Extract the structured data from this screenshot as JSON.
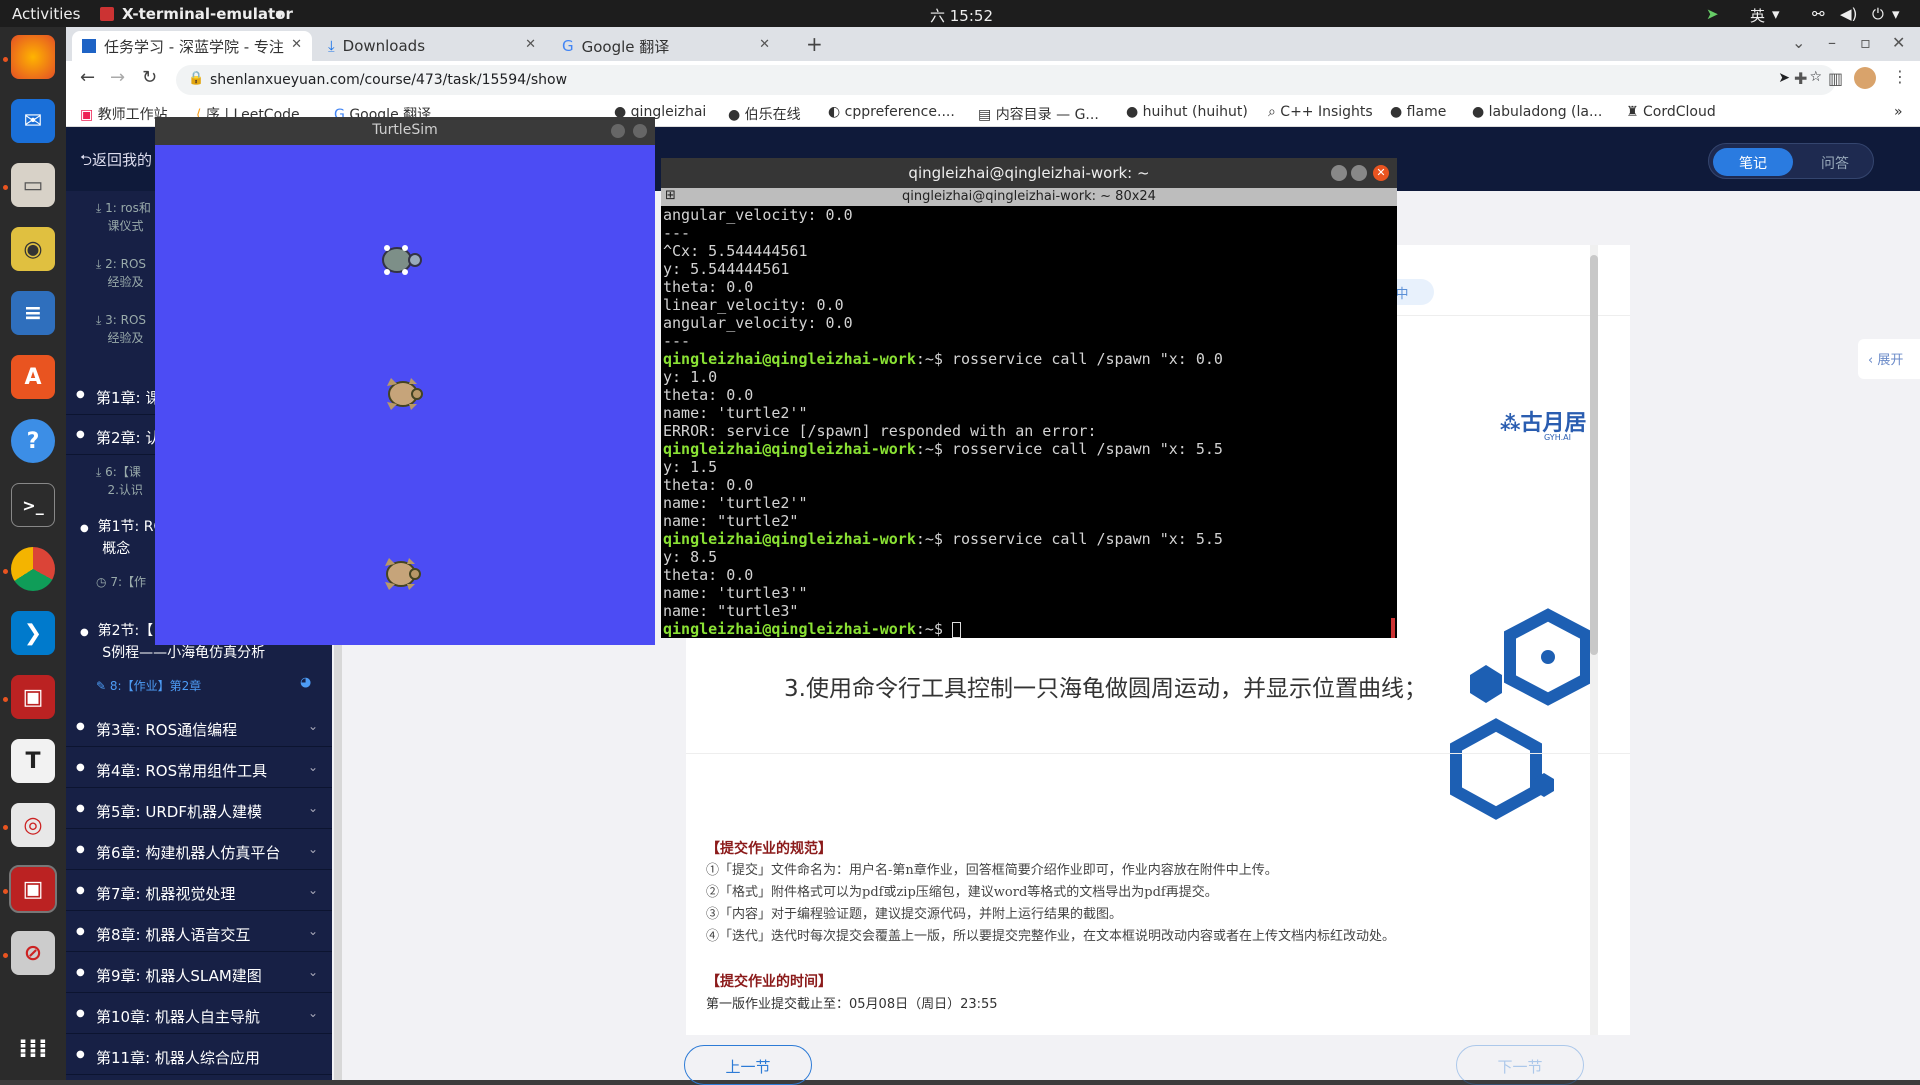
{
  "topbar": {
    "activities": "Activities",
    "app": "X-terminal-emulator",
    "clock": "六 15:52",
    "lang": "英"
  },
  "dock": {
    "items": [
      "firefox",
      "thunderbird",
      "files",
      "rhythmbox",
      "writer",
      "software",
      "help",
      "terminal",
      "chrome",
      "vscode",
      "app-red",
      "typora",
      "app-red2",
      "app-red3",
      "app-blocked",
      "show-apps"
    ]
  },
  "browser": {
    "tabs": [
      {
        "label": "任务学习 - 深蓝学院 - 专注"
      },
      {
        "label": "Downloads"
      },
      {
        "label": "Google 翻译"
      }
    ],
    "new_tab": "+",
    "url": "shenlanxueyuan.com/course/473/task/15594/show",
    "bookmarks": [
      "教师工作站",
      "序 | LeetCode",
      "Google 翻译",
      "qingleizhai",
      "伯乐在线",
      "cppreference....",
      "内容目录 — G...",
      "huihut (huihut)",
      "C++ Insights",
      "flame",
      "labuladong (la...",
      "CordCloud"
    ]
  },
  "page": {
    "back": "返回我的",
    "notes_tab": "笔记",
    "qa_tab": "问答",
    "expand": "展开",
    "status_badge": "答题中",
    "logo_text": "古月居",
    "logo_sub": "GYH.AI",
    "task_heading": "3.使用命令行工具控制一只海龟做圆周运动，并显示位置曲线；",
    "rules_title": "【提交作业的规范】",
    "rules": [
      "①「提交」文件命名为：用户名-第n章作业，回答框简要介绍作业即可，作业内容放在附件中上传。",
      "②「格式」附件格式可以为pdf或zip压缩包，建议word等格式的文档导出为pdf再提交。",
      "③「内容」对于编程验证题，建议提交源代码，并附上运行结果的截图。",
      "④「迭代」迭代时每次提交会覆盖上一版，所以要提交完整作业，在文本框说明改动内容或者在上传文档内标红改动处。"
    ],
    "time_title": "【提交作业的时间】",
    "time_line": "第一版作业提交截止至：05月08日（周日）23:55",
    "prev": "上一节",
    "next": "下一节"
  },
  "sidebar": {
    "lessons_top": [
      {
        "l1": "1: ros和",
        "l2": "课仪式"
      },
      {
        "l1": "2: ROS",
        "l2": "经验及"
      },
      {
        "l1": "3: ROS",
        "l2": "经验及"
      }
    ],
    "ch1": "第1章: 课",
    "ch2": "第2章: 认",
    "lesson6_l1": "6:【课",
    "lesson6_l2": "2.认识",
    "sec1_l1": "第1节: RO",
    "sec1_l2": "概念",
    "lesson7": "7:【作",
    "sec2_l1": "第2节:【",
    "sec2_l2": "S例程——小海龟仿真分析",
    "lesson8": "8:【作业】第2章",
    "chapters": [
      "第3章: ROS通信编程",
      "第4章: ROS常用组件工具",
      "第5章: URDF机器人建模",
      "第6章: 构建机器人仿真平台",
      "第7章: 机器视觉处理",
      "第8章: 机器人语音交互",
      "第9章: 机器人SLAM建图",
      "第10章: 机器人自主导航",
      "第11章: 机器人综合应用"
    ]
  },
  "turtlesim": {
    "title": "TurtleSim",
    "background": "#4c4cf4"
  },
  "terminal": {
    "title": "qingleizhai@qingleizhai-work: ~",
    "subtitle": "qingleizhai@qingleizhai-work: ~ 80x24",
    "prompt": "qingleizhai@qingleizhai-work",
    "lines": [
      {
        "t": "o",
        "s": "angular_velocity: 0.0"
      },
      {
        "t": "o",
        "s": "---"
      },
      {
        "t": "o",
        "s": "^Cx: 5.544444561"
      },
      {
        "t": "o",
        "s": "y: 5.544444561"
      },
      {
        "t": "o",
        "s": "theta: 0.0"
      },
      {
        "t": "o",
        "s": "linear_velocity: 0.0"
      },
      {
        "t": "o",
        "s": "angular_velocity: 0.0"
      },
      {
        "t": "o",
        "s": "---"
      },
      {
        "t": "p",
        "s": ":~$ rosservice call /spawn \"x: 0.0"
      },
      {
        "t": "o",
        "s": "y: 1.0"
      },
      {
        "t": "o",
        "s": "theta: 0.0"
      },
      {
        "t": "o",
        "s": "name: 'turtle2'\""
      },
      {
        "t": "o",
        "s": "ERROR: service [/spawn] responded with an error:"
      },
      {
        "t": "p",
        "s": ":~$ rosservice call /spawn \"x: 5.5"
      },
      {
        "t": "o",
        "s": "y: 1.5"
      },
      {
        "t": "o",
        "s": "theta: 0.0"
      },
      {
        "t": "o",
        "s": "name: 'turtle2'\""
      },
      {
        "t": "o",
        "s": "name: \"turtle2\""
      },
      {
        "t": "p",
        "s": ":~$ rosservice call /spawn \"x: 5.5"
      },
      {
        "t": "o",
        "s": "y: 8.5"
      },
      {
        "t": "o",
        "s": "theta: 0.0"
      },
      {
        "t": "o",
        "s": "name: 'turtle3'\""
      },
      {
        "t": "o",
        "s": "name: \"turtle3\""
      },
      {
        "t": "p",
        "s": ":~$ "
      }
    ]
  }
}
